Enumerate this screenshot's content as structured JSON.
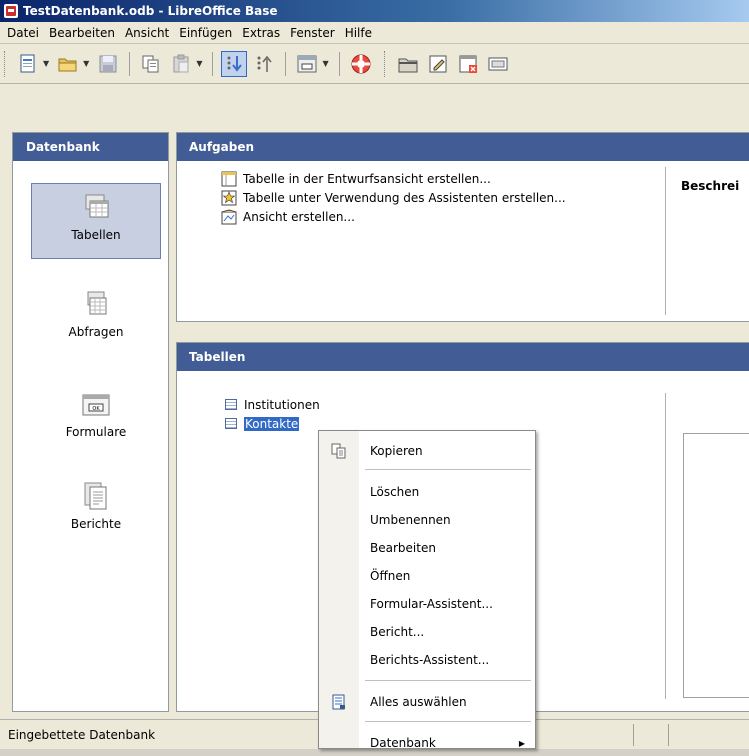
{
  "window": {
    "title": "TestDatenbank.odb - LibreOffice Base"
  },
  "menubar": {
    "items": [
      "Datei",
      "Bearbeiten",
      "Ansicht",
      "Einfügen",
      "Extras",
      "Fenster",
      "Hilfe"
    ]
  },
  "toolbar": {
    "buttons": [
      "new-document-icon",
      "open-folder-icon",
      "save-icon",
      "copy-icon",
      "paste-icon",
      "sort-ascending-icon",
      "sort-descending-icon",
      "form-control-icon",
      "help-lifebuoy-icon",
      "open-database-object-icon",
      "edit-icon",
      "delete-icon",
      "rename-icon"
    ]
  },
  "left_pane": {
    "title": "Datenbank",
    "items": [
      {
        "label": "Tabellen",
        "icon": "tables-icon",
        "selected": true
      },
      {
        "label": "Abfragen",
        "icon": "queries-icon",
        "selected": false
      },
      {
        "label": "Formulare",
        "icon": "forms-icon",
        "selected": false
      },
      {
        "label": "Berichte",
        "icon": "reports-icon",
        "selected": false
      }
    ]
  },
  "tasks_pane": {
    "title": "Aufgaben",
    "description_label": "Beschrei",
    "items": [
      {
        "label": "Tabelle in der Entwurfsansicht erstellen...",
        "icon": "design-view-icon"
      },
      {
        "label": "Tabelle unter Verwendung des Assistenten erstellen...",
        "icon": "wizard-icon"
      },
      {
        "label": "Ansicht erstellen...",
        "icon": "create-view-icon"
      }
    ]
  },
  "tables_pane": {
    "title": "Tabellen",
    "items": [
      {
        "label": "Institutionen",
        "selected": false
      },
      {
        "label": "Kontakte",
        "selected": true
      }
    ]
  },
  "context_menu": {
    "items": [
      {
        "label": "Kopieren",
        "icon": "copy-icon"
      },
      {
        "label": "Löschen"
      },
      {
        "label": "Umbenennen"
      },
      {
        "label": "Bearbeiten"
      },
      {
        "label": "Öffnen"
      },
      {
        "label": "Formular-Assistent..."
      },
      {
        "label": "Bericht..."
      },
      {
        "label": "Berichts-Assistent..."
      },
      {
        "label": "Alles auswählen",
        "icon": "select-all-icon"
      },
      {
        "label": "Datenbank",
        "submenu": true
      }
    ]
  },
  "statusbar": {
    "text": "Eingebettete Datenbank"
  },
  "colors": {
    "accent": "#316ac5",
    "pane_header": "#425c96",
    "title_bar": "#0a246a"
  }
}
